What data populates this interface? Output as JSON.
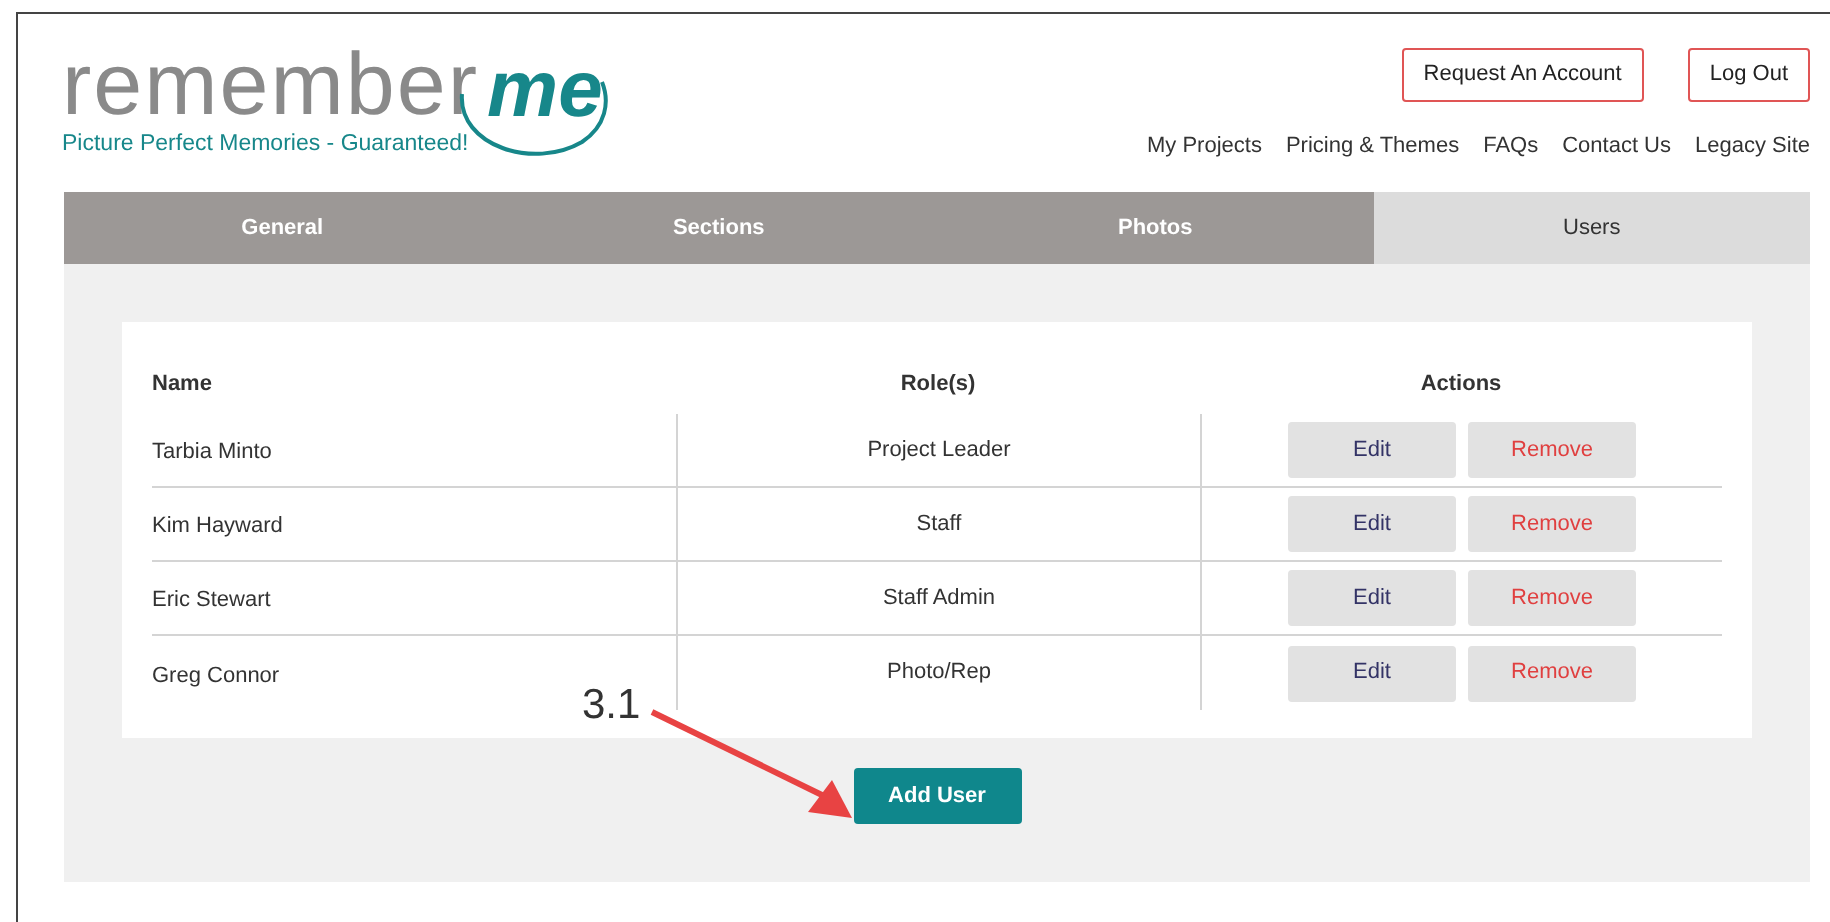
{
  "logo": {
    "word": "remember",
    "accent": "me",
    "tagline": "Picture Perfect Memories - Guaranteed!"
  },
  "header_buttons": [
    "Request An Account",
    "Log Out"
  ],
  "nav_links": [
    "My Projects",
    "Pricing & Themes",
    "FAQs",
    "Contact Us",
    "Legacy Site"
  ],
  "tabs": [
    {
      "label": "General",
      "selected": false
    },
    {
      "label": "Sections",
      "selected": false
    },
    {
      "label": "Photos",
      "selected": false
    },
    {
      "label": "Users",
      "selected": true
    }
  ],
  "table": {
    "columns": [
      "Name",
      "Role(s)",
      "Actions"
    ],
    "rows": [
      {
        "name": "Tarbia Minto",
        "role": "Project Leader",
        "actions": [
          "Edit",
          "Remove"
        ]
      },
      {
        "name": "Kim Hayward",
        "role": "Staff",
        "actions": [
          "Edit",
          "Remove"
        ]
      },
      {
        "name": "Eric Stewart",
        "role": "Staff Admin",
        "actions": [
          "Edit",
          "Remove"
        ]
      },
      {
        "name": "Greg Connor",
        "role": "Photo/Rep",
        "actions": [
          "Edit",
          "Remove"
        ]
      }
    ]
  },
  "add_button": "Add User",
  "annotation": {
    "label": "3.1"
  }
}
